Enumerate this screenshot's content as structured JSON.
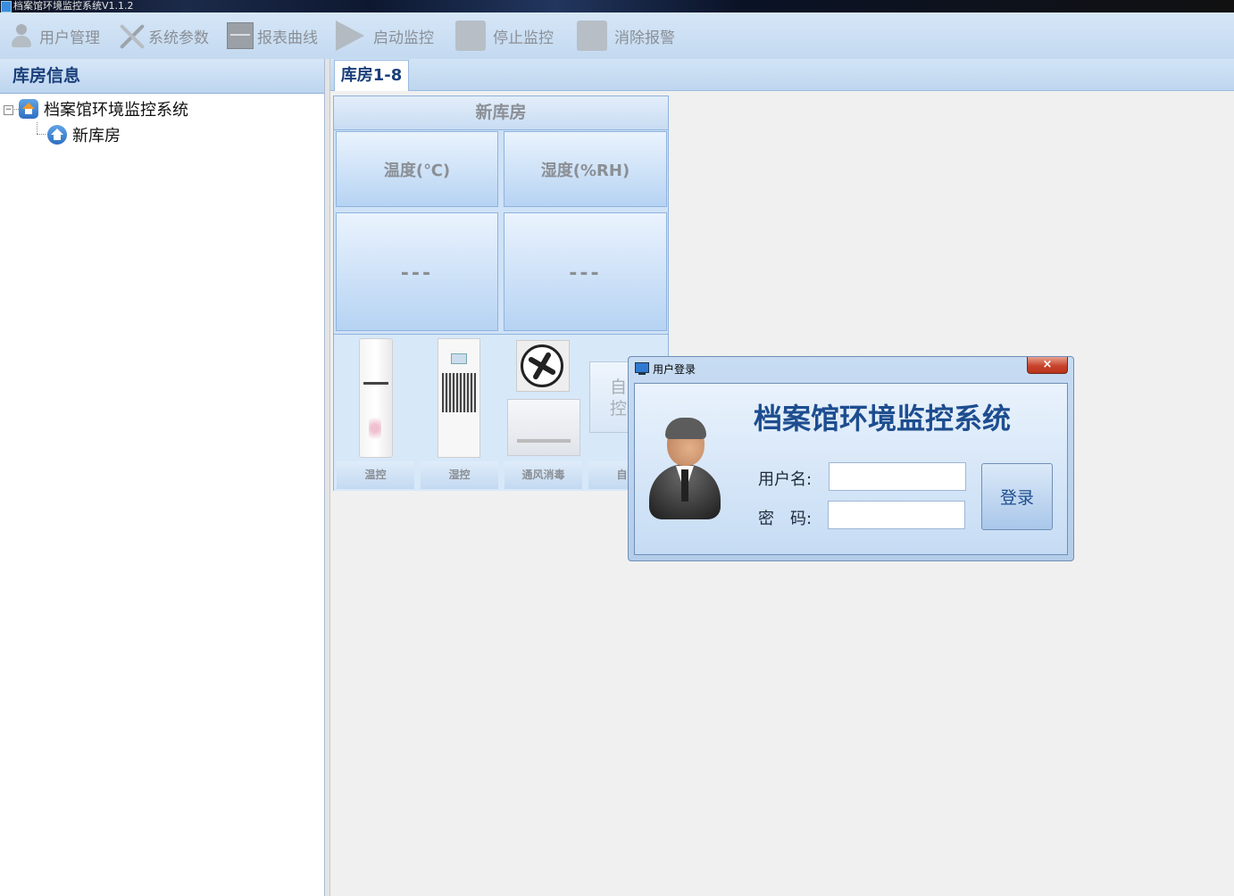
{
  "window": {
    "title": "档案馆环境监控系统V1.1.2"
  },
  "toolbar": {
    "items": [
      {
        "label": "用户管理",
        "icon": "user-icon"
      },
      {
        "label": "系统参数",
        "icon": "tools-icon"
      },
      {
        "label": "报表曲线",
        "icon": "report-icon"
      },
      {
        "label": "启动监控",
        "icon": "play-icon"
      },
      {
        "label": "停止监控",
        "icon": "stop-icon"
      },
      {
        "label": "消除报警",
        "icon": "clear-alarm-icon"
      }
    ]
  },
  "sidebar": {
    "header": "库房信息",
    "tree": {
      "root": {
        "label": "档案馆环境监控系统",
        "expander": "−"
      },
      "children": [
        {
          "label": "新库房"
        }
      ]
    }
  },
  "tabs": [
    {
      "label": "库房1-8",
      "active": true
    }
  ],
  "room": {
    "title": "新库房",
    "temperature": {
      "label": "温度(℃)",
      "value": "---"
    },
    "humidity": {
      "label": "湿度(%RH)",
      "value": "---"
    },
    "devices": [
      {
        "label": "温控",
        "icon": "air-conditioner-icon"
      },
      {
        "label": "湿控",
        "icon": "dehumidifier-icon"
      },
      {
        "label": "通风消毒",
        "icon": "ventilation-fan-icon"
      },
      {
        "label": "自动"
      }
    ],
    "auto_button": {
      "line1": "自",
      "line2": "控"
    }
  },
  "login_dialog": {
    "title": "用户登录",
    "close_label": "×",
    "heading": "档案馆环境监控系统",
    "username_label": "用户名:",
    "password_label": "密　码:",
    "username_value": "",
    "password_value": "",
    "login_button": "登录"
  }
}
